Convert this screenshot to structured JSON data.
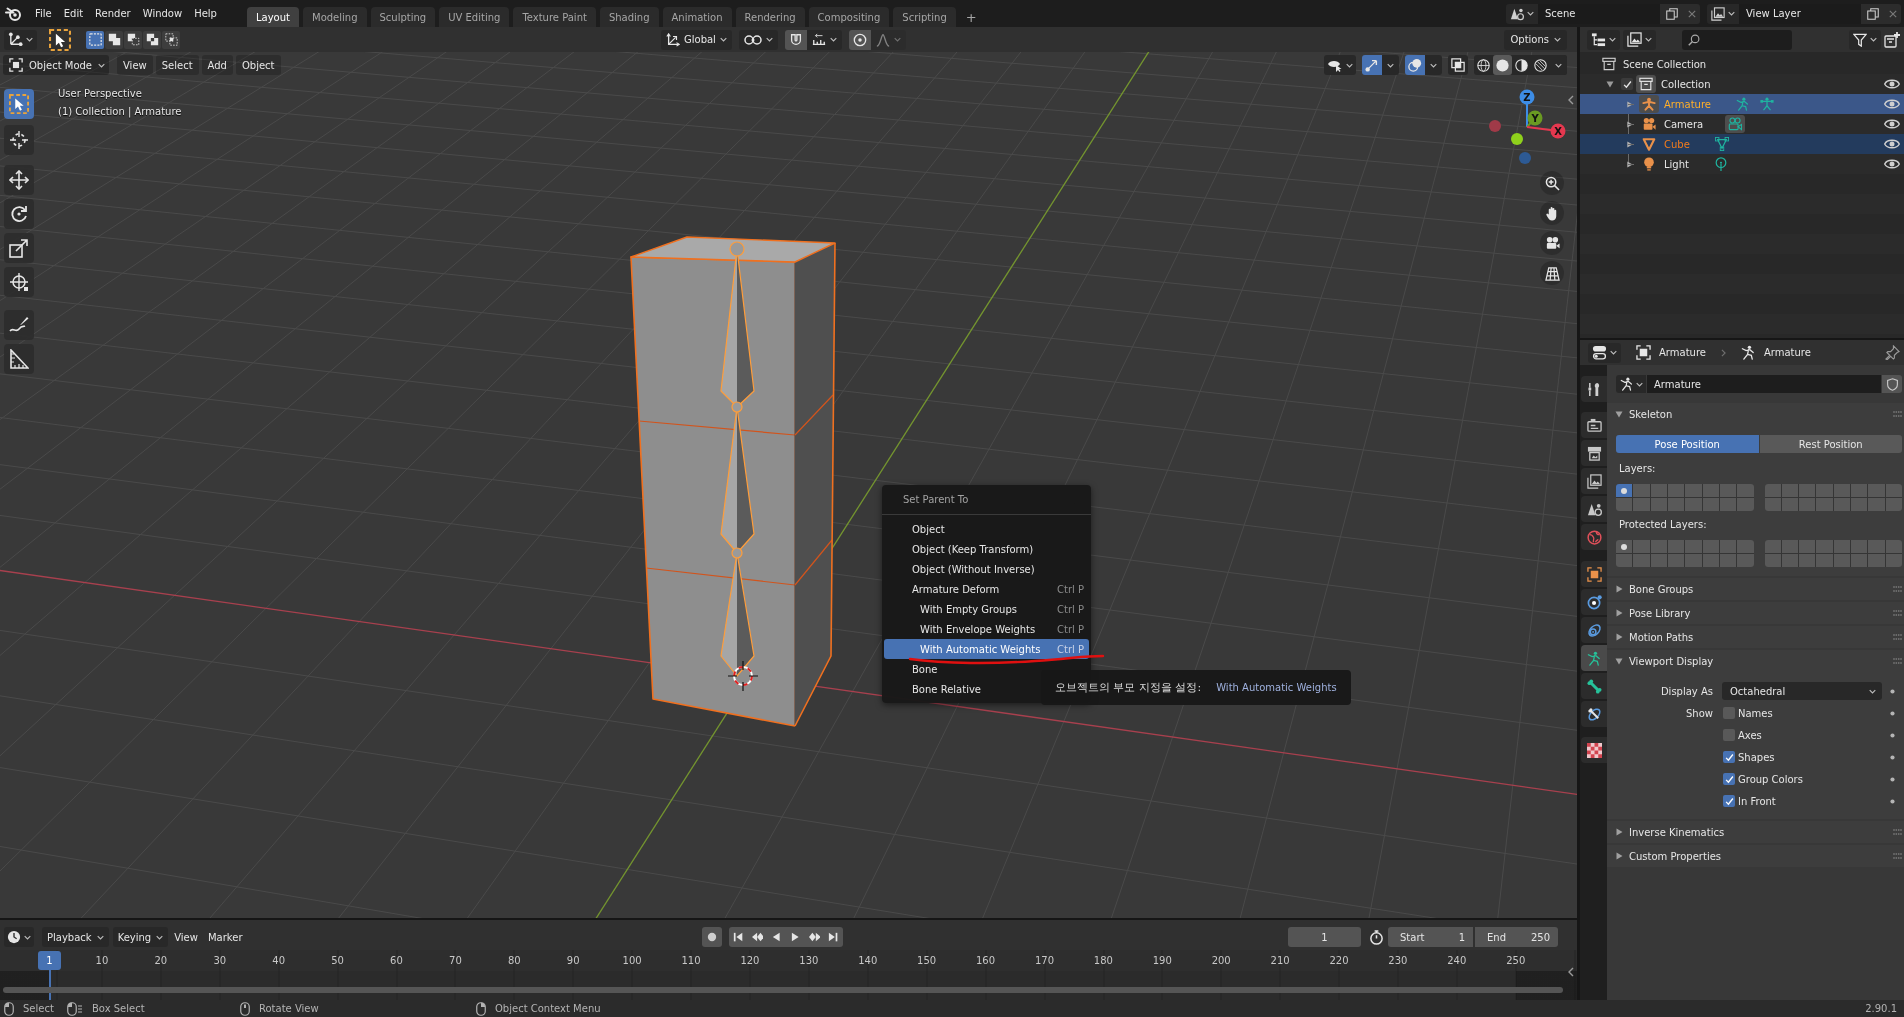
{
  "topbar": {
    "menus": [
      "File",
      "Edit",
      "Render",
      "Window",
      "Help"
    ],
    "workspaces": [
      {
        "label": "Layout",
        "selected": true
      },
      {
        "label": "Modeling",
        "selected": false
      },
      {
        "label": "Sculpting",
        "selected": false
      },
      {
        "label": "UV Editing",
        "selected": false
      },
      {
        "label": "Texture Paint",
        "selected": false
      },
      {
        "label": "Shading",
        "selected": false
      },
      {
        "label": "Animation",
        "selected": false
      },
      {
        "label": "Rendering",
        "selected": false
      },
      {
        "label": "Compositing",
        "selected": false
      },
      {
        "label": "Scripting",
        "selected": false
      }
    ],
    "add_workspace": "+",
    "scene": "Scene",
    "view_layer": "View Layer"
  },
  "tool_header": {
    "select_modes": [
      {
        "kind": "set",
        "selected": true
      },
      {
        "kind": "extend",
        "selected": false
      },
      {
        "kind": "subtract",
        "selected": false
      },
      {
        "kind": "difference",
        "selected": false
      },
      {
        "kind": "intersect",
        "selected": false
      }
    ],
    "orientation": "Global",
    "snap": {
      "on": false
    },
    "proportional": {
      "on": false
    },
    "options": "Options"
  },
  "viewport": {
    "mode": "Object Mode",
    "menus": [
      "View",
      "Select",
      "Add",
      "Object"
    ],
    "toggles": [
      {
        "kind": "gizmos",
        "on": true
      },
      {
        "kind": "overlays",
        "on": true
      },
      {
        "kind": "xray",
        "on": false
      }
    ],
    "shading": [
      {
        "kind": "wireframe",
        "selected": false
      },
      {
        "kind": "solid",
        "selected": true
      },
      {
        "kind": "material",
        "selected": false
      },
      {
        "kind": "rendered",
        "selected": false
      }
    ],
    "view_name": "User Perspective",
    "view_info": "(1) Collection | Armature",
    "tools": [
      {
        "kind": "select",
        "selected": true
      },
      {
        "kind": "cursor",
        "selected": false
      },
      {
        "kind": "move",
        "selected": false
      },
      {
        "kind": "rotate",
        "selected": false
      },
      {
        "kind": "scale",
        "selected": false
      },
      {
        "kind": "transform",
        "selected": false
      },
      {
        "kind": "annotate",
        "selected": false
      },
      {
        "kind": "measure",
        "selected": false
      }
    ],
    "axes": [
      {
        "kind": "z",
        "label": "Z"
      },
      {
        "kind": "y",
        "label": "Y"
      },
      {
        "kind": "x",
        "label": "X"
      }
    ]
  },
  "context_menu": {
    "title": "Set Parent To",
    "items": [
      {
        "label": "Object",
        "selected": false
      },
      {
        "label": "Object (Keep Transform)",
        "selected": false
      },
      {
        "label": "Object (Without Inverse)",
        "selected": false
      },
      {
        "label": "Armature Deform",
        "shortcut": "Ctrl P",
        "selected": false,
        "children": [
          {
            "label": "With Empty Groups",
            "shortcut": "Ctrl P",
            "selected": false
          },
          {
            "label": "With Envelope Weights",
            "shortcut": "Ctrl P",
            "selected": false
          },
          {
            "label": "With Automatic Weights",
            "shortcut": "Ctrl P",
            "selected": true
          }
        ]
      },
      {
        "label": "Bone",
        "selected": false
      },
      {
        "label": "Bone Relative",
        "selected": false
      }
    ]
  },
  "tooltip": {
    "label": "오브젝트의 부모 지정을 설정:",
    "value": "With Automatic Weights"
  },
  "outliner": {
    "root": "Scene Collection",
    "tree": [
      {
        "label": "Collection",
        "selected": false,
        "active": true,
        "checked": true,
        "expanded": true,
        "visible": true,
        "children": [
          {
            "label": "Armature",
            "kind": "armature",
            "selected": true,
            "active": true,
            "expanded": false,
            "visible": true,
            "data": [
              {
                "kind": "armature",
                "active": false
              },
              {
                "kind": "pose",
                "active": false
              }
            ]
          },
          {
            "label": "Camera",
            "kind": "camera",
            "selected": false,
            "active": false,
            "expanded": false,
            "visible": true,
            "data": [
              {
                "kind": "camera",
                "active": true
              }
            ]
          },
          {
            "label": "Cube",
            "kind": "mesh",
            "selected": true,
            "active": false,
            "expanded": false,
            "visible": true,
            "data": [
              {
                "kind": "mesh",
                "active": false
              }
            ]
          },
          {
            "label": "Light",
            "kind": "light",
            "selected": false,
            "active": false,
            "expanded": false,
            "visible": true,
            "data": [
              {
                "kind": "light",
                "active": false
              }
            ]
          }
        ]
      }
    ]
  },
  "properties": {
    "context": [
      {
        "kind": "object",
        "label": "Armature"
      },
      {
        "kind": "armature",
        "label": "Armature"
      }
    ],
    "tabs": [
      {
        "kind": "tool",
        "selected": false
      },
      {
        "kind": "render",
        "selected": false
      },
      {
        "kind": "output",
        "selected": false
      },
      {
        "kind": "view_layer",
        "selected": false
      },
      {
        "kind": "scene",
        "selected": false
      },
      {
        "kind": "world",
        "selected": false
      },
      {
        "kind": "object",
        "selected": false
      },
      {
        "kind": "physics",
        "selected": false
      },
      {
        "kind": "constraints",
        "selected": false
      },
      {
        "kind": "armature",
        "selected": true
      },
      {
        "kind": "bone",
        "selected": false
      },
      {
        "kind": "bone_constraints",
        "selected": false
      },
      {
        "kind": "texture",
        "selected": false
      }
    ],
    "datablock": "Armature",
    "panels": [
      {
        "kind": "skeleton",
        "title": "Skeleton",
        "expanded": true,
        "positions": [
          {
            "label": "Pose Position",
            "selected": true
          },
          {
            "label": "Rest Position",
            "selected": false
          }
        ],
        "layers_label": "Layers:",
        "layers": [
          {
            "on": true,
            "used": true
          },
          {
            "on": false,
            "used": false
          },
          {
            "on": false,
            "used": false
          },
          {
            "on": false,
            "used": false
          },
          {
            "on": false,
            "used": false
          },
          {
            "on": false,
            "used": false
          },
          {
            "on": false,
            "used": false
          },
          {
            "on": false,
            "used": false
          },
          {
            "on": false,
            "used": false
          },
          {
            "on": false,
            "used": false
          },
          {
            "on": false,
            "used": false
          },
          {
            "on": false,
            "used": false
          },
          {
            "on": false,
            "used": false
          },
          {
            "on": false,
            "used": false
          },
          {
            "on": false,
            "used": false
          },
          {
            "on": false,
            "used": false
          },
          {
            "on": false,
            "used": false
          },
          {
            "on": false,
            "used": false
          },
          {
            "on": false,
            "used": false
          },
          {
            "on": false,
            "used": false
          },
          {
            "on": false,
            "used": false
          },
          {
            "on": false,
            "used": false
          },
          {
            "on": false,
            "used": false
          },
          {
            "on": false,
            "used": false
          },
          {
            "on": false,
            "used": false
          },
          {
            "on": false,
            "used": false
          },
          {
            "on": false,
            "used": false
          },
          {
            "on": false,
            "used": false
          },
          {
            "on": false,
            "used": false
          },
          {
            "on": false,
            "used": false
          },
          {
            "on": false,
            "used": false
          },
          {
            "on": false,
            "used": false
          }
        ],
        "protected_label": "Protected Layers:",
        "protected": [
          {
            "on": false,
            "used": true
          },
          {
            "on": false,
            "used": false
          },
          {
            "on": false,
            "used": false
          },
          {
            "on": false,
            "used": false
          },
          {
            "on": false,
            "used": false
          },
          {
            "on": false,
            "used": false
          },
          {
            "on": false,
            "used": false
          },
          {
            "on": false,
            "used": false
          },
          {
            "on": false,
            "used": false
          },
          {
            "on": false,
            "used": false
          },
          {
            "on": false,
            "used": false
          },
          {
            "on": false,
            "used": false
          },
          {
            "on": false,
            "used": false
          },
          {
            "on": false,
            "used": false
          },
          {
            "on": false,
            "used": false
          },
          {
            "on": false,
            "used": false
          },
          {
            "on": false,
            "used": false
          },
          {
            "on": false,
            "used": false
          },
          {
            "on": false,
            "used": false
          },
          {
            "on": false,
            "used": false
          },
          {
            "on": false,
            "used": false
          },
          {
            "on": false,
            "used": false
          },
          {
            "on": false,
            "used": false
          },
          {
            "on": false,
            "used": false
          },
          {
            "on": false,
            "used": false
          },
          {
            "on": false,
            "used": false
          },
          {
            "on": false,
            "used": false
          },
          {
            "on": false,
            "used": false
          },
          {
            "on": false,
            "used": false
          },
          {
            "on": false,
            "used": false
          },
          {
            "on": false,
            "used": false
          },
          {
            "on": false,
            "used": false
          }
        ]
      },
      {
        "title": "Bone Groups",
        "expanded": false
      },
      {
        "title": "Pose Library",
        "expanded": false
      },
      {
        "title": "Motion Paths",
        "expanded": false
      },
      {
        "kind": "display",
        "title": "Viewport Display",
        "expanded": true,
        "display_as_label": "Display As",
        "display_as": "Octahedral",
        "show_label": "Show",
        "options": [
          {
            "label": "Names",
            "checked": false
          },
          {
            "label": "Axes",
            "checked": false
          },
          {
            "label": "Shapes",
            "checked": true
          },
          {
            "label": "Group Colors",
            "checked": true
          },
          {
            "label": "In Front",
            "checked": true
          }
        ]
      },
      {
        "title": "Inverse Kinematics",
        "expanded": false
      },
      {
        "title": "Custom Properties",
        "expanded": false
      }
    ]
  },
  "timeline": {
    "menus": [
      {
        "label": "Playback",
        "dropdown": true
      },
      {
        "label": "Keying",
        "dropdown": true
      },
      {
        "label": "View",
        "dropdown": false
      },
      {
        "label": "Marker",
        "dropdown": false
      }
    ],
    "frame": "1",
    "start_label": "Start",
    "start": "1",
    "end_label": "End",
    "end": "250",
    "playhead": "1",
    "ticks": [
      "10",
      "20",
      "30",
      "40",
      "50",
      "60",
      "70",
      "80",
      "90",
      "100",
      "110",
      "120",
      "130",
      "140",
      "150",
      "160",
      "170",
      "180",
      "190",
      "200",
      "210",
      "220",
      "230",
      "240",
      "250"
    ]
  },
  "status_bar": {
    "hints": [
      {
        "kind": "left",
        "label": "Select"
      },
      {
        "kind": "drag",
        "label": "Box Select"
      },
      {
        "kind": "middle",
        "label": "Rotate View"
      },
      {
        "kind": "right",
        "label": "Object Context Menu"
      }
    ],
    "version": "2.90.1"
  }
}
